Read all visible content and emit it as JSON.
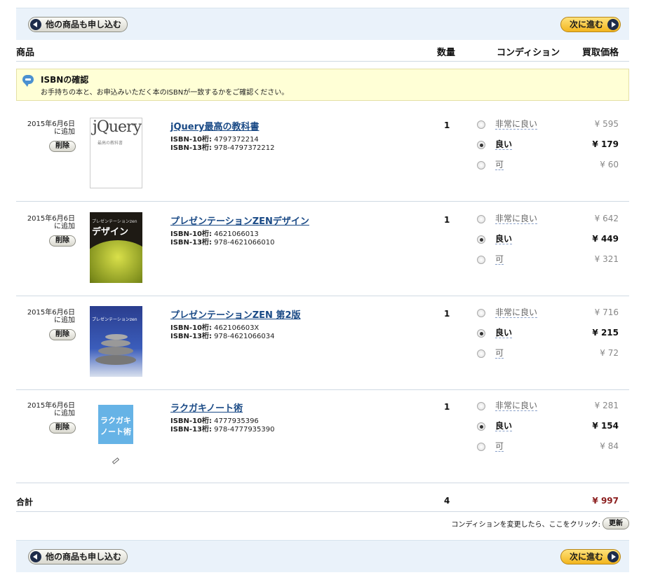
{
  "nav": {
    "back_label": "他の商品も申し込む",
    "next_label": "次に進む"
  },
  "header": {
    "product": "商品",
    "quantity": "数量",
    "condition": "コンディション",
    "price": "買取価格"
  },
  "isbn_notice": {
    "title": "ISBNの確認",
    "desc": "お手持ちの本と、お申込みいただく本のISBNが一致するかをご確認ください。"
  },
  "items": [
    {
      "date": "2015年6月6日",
      "added": "に追加",
      "delete": "削除",
      "title": "jQuery最高の教科書",
      "isbn10_label": "ISBN-10桁:",
      "isbn10": "4797372214",
      "isbn13_label": "ISBN-13桁:",
      "isbn13": "978-4797372212",
      "qty": "1",
      "conditions": [
        "非常に良い",
        "良い",
        "可"
      ],
      "selected": 1,
      "prices": [
        "¥ 595",
        "¥ 179",
        "¥ 60"
      ],
      "cover": {
        "text": "jQuery",
        "sub": "最高の教科書"
      }
    },
    {
      "date": "2015年6月6日",
      "added": "に追加",
      "delete": "削除",
      "title": "プレゼンテーションZENデザイン",
      "isbn10_label": "ISBN-10桁:",
      "isbn10": "4621066013",
      "isbn13_label": "ISBN-13桁:",
      "isbn13": "978-4621066010",
      "qty": "1",
      "conditions": [
        "非常に良い",
        "良い",
        "可"
      ],
      "selected": 1,
      "prices": [
        "¥ 642",
        "¥ 449",
        "¥ 321"
      ],
      "cover": {
        "text": "デザイン",
        "sub": "プレゼンテーションzen"
      }
    },
    {
      "date": "2015年6月6日",
      "added": "に追加",
      "delete": "削除",
      "title": "プレゼンテーションZEN 第2版",
      "isbn10_label": "ISBN-10桁:",
      "isbn10": "462106603X",
      "isbn13_label": "ISBN-13桁:",
      "isbn13": "978-4621066034",
      "qty": "1",
      "conditions": [
        "非常に良い",
        "良い",
        "可"
      ],
      "selected": 1,
      "prices": [
        "¥ 716",
        "¥ 215",
        "¥ 72"
      ],
      "cover": {
        "text": "プレゼンテーションzen",
        "sub": ""
      }
    },
    {
      "date": "2015年6月6日",
      "added": "に追加",
      "delete": "削除",
      "title": "ラクガキノート術",
      "isbn10_label": "ISBN-10桁:",
      "isbn10": "4777935396",
      "isbn13_label": "ISBN-13桁:",
      "isbn13": "978-4777935390",
      "qty": "1",
      "conditions": [
        "非常に良い",
        "良い",
        "可"
      ],
      "selected": 1,
      "prices": [
        "¥ 281",
        "¥ 154",
        "¥ 84"
      ],
      "cover": {
        "text": "ラクガキ",
        "sub": "ノート術"
      }
    }
  ],
  "total": {
    "label": "合計",
    "qty": "4",
    "price": "¥ 997"
  },
  "update": {
    "text": "コンディションを変更したら、ここをクリック:",
    "button": "更新"
  },
  "colors": {
    "nav_bg": "#eaf2fa",
    "next_button": "#f2b51e",
    "link": "#1a4a86",
    "total_price": "#8b1e1e",
    "notice_bg": "#ffffd6"
  }
}
